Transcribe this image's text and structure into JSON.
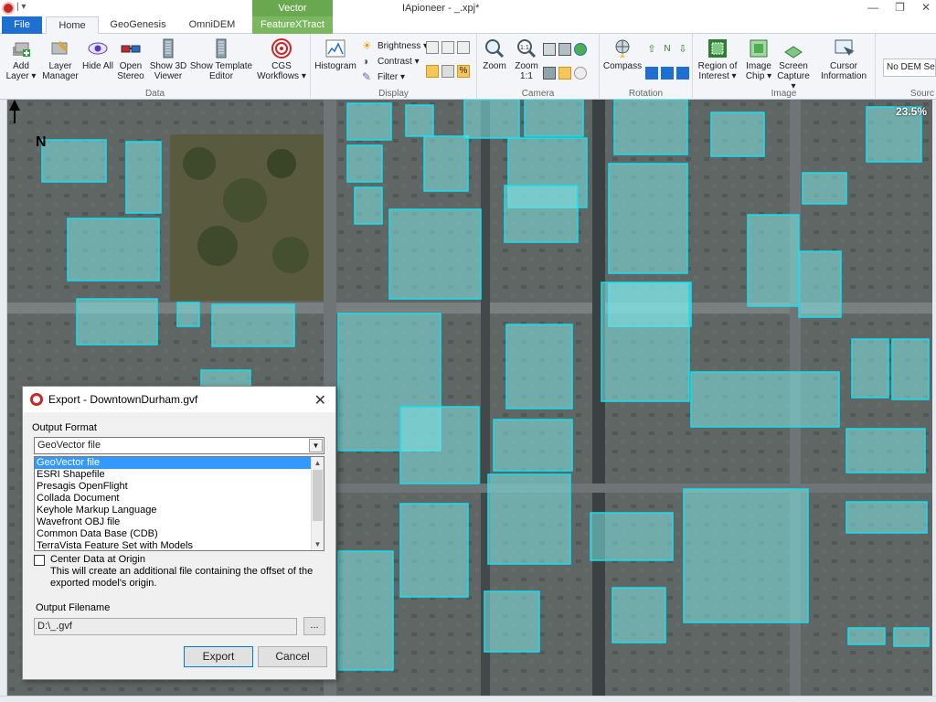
{
  "window": {
    "title": "IApioneer - _.xpj*",
    "qat": "| ▾",
    "controls": {
      "minimize": "—",
      "restore": "❐",
      "close": "✕"
    }
  },
  "tabs": {
    "file": "File",
    "home": "Home",
    "geogenesis": "GeoGenesis",
    "omnidem": "OmniDEM",
    "context_group": "Vector",
    "featurextract": "FeatureXTract"
  },
  "ribbon": {
    "data": {
      "label": "Data",
      "add_layer": "Add Layer ▾",
      "layer_manager": "Layer Manager",
      "hide_all": "Hide All",
      "open_stereo": "Open Stereo",
      "show_3d_viewer": "Show 3D Viewer",
      "show_template_editor": "Show Template Editor",
      "cgs_workflows": "CGS Workflows ▾"
    },
    "display": {
      "label": "Display",
      "histogram": "Histogram",
      "brightness": "Brightness ▾",
      "contrast": "Contrast ▾",
      "filter": "Filter ▾"
    },
    "camera": {
      "label": "Camera",
      "zoom": "Zoom",
      "zoom_1_1": "Zoom 1:1"
    },
    "rotation": {
      "label": "Rotation",
      "compass": "Compass"
    },
    "image": {
      "label": "Image",
      "region_of_interest": "Region of Interest ▾",
      "image_chip": "Image Chip ▾",
      "screen_capture": "Screen Capture ▾",
      "cursor_information": "Cursor Information"
    },
    "source": {
      "label": "Sourc",
      "dem_value": "No DEM Se"
    }
  },
  "map": {
    "zoom_readout": "23.5%",
    "north_label": "N"
  },
  "dialog": {
    "title": "Export - DowntownDurham.gvf",
    "output_format_label": "Output Format",
    "selected_format": "GeoVector file",
    "formats": [
      "GeoVector file",
      "ESRI Shapefile",
      "Presagis OpenFlight",
      "Collada Document",
      "Keyhole Markup Language",
      "Wavefront OBJ file",
      "Common Data Base (CDB)",
      "TerraVista Feature Set with Models"
    ],
    "center_label": "Center Data at Origin",
    "center_desc_1": "This will create an additional file containing the offset of the",
    "center_desc_2": "exported model's origin.",
    "output_filename_label": "Output Filename",
    "output_filename": "D:\\_.gvf",
    "browse": "...",
    "export": "Export",
    "cancel": "Cancel"
  }
}
